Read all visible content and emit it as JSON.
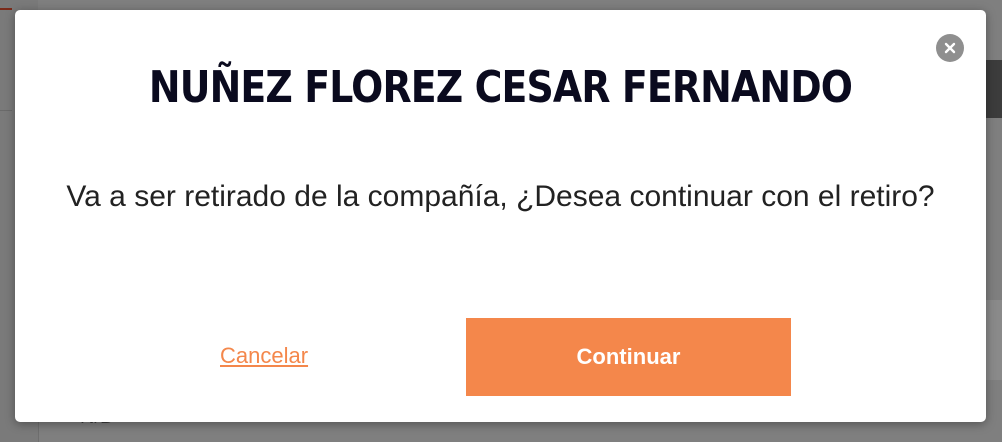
{
  "background": {
    "cell_text": "N/D"
  },
  "modal": {
    "title": "NUÑEZ FLOREZ CESAR FERNANDO",
    "message": "Va a ser retirado de la compañía, ¿Desea continuar con el retiro?",
    "cancel_label": "Cancelar",
    "continue_label": "Continuar",
    "close_icon": "close-icon"
  },
  "colors": {
    "accent": "#f4874b",
    "overlay": "#7f7f7f",
    "title": "#0a0a1e"
  }
}
